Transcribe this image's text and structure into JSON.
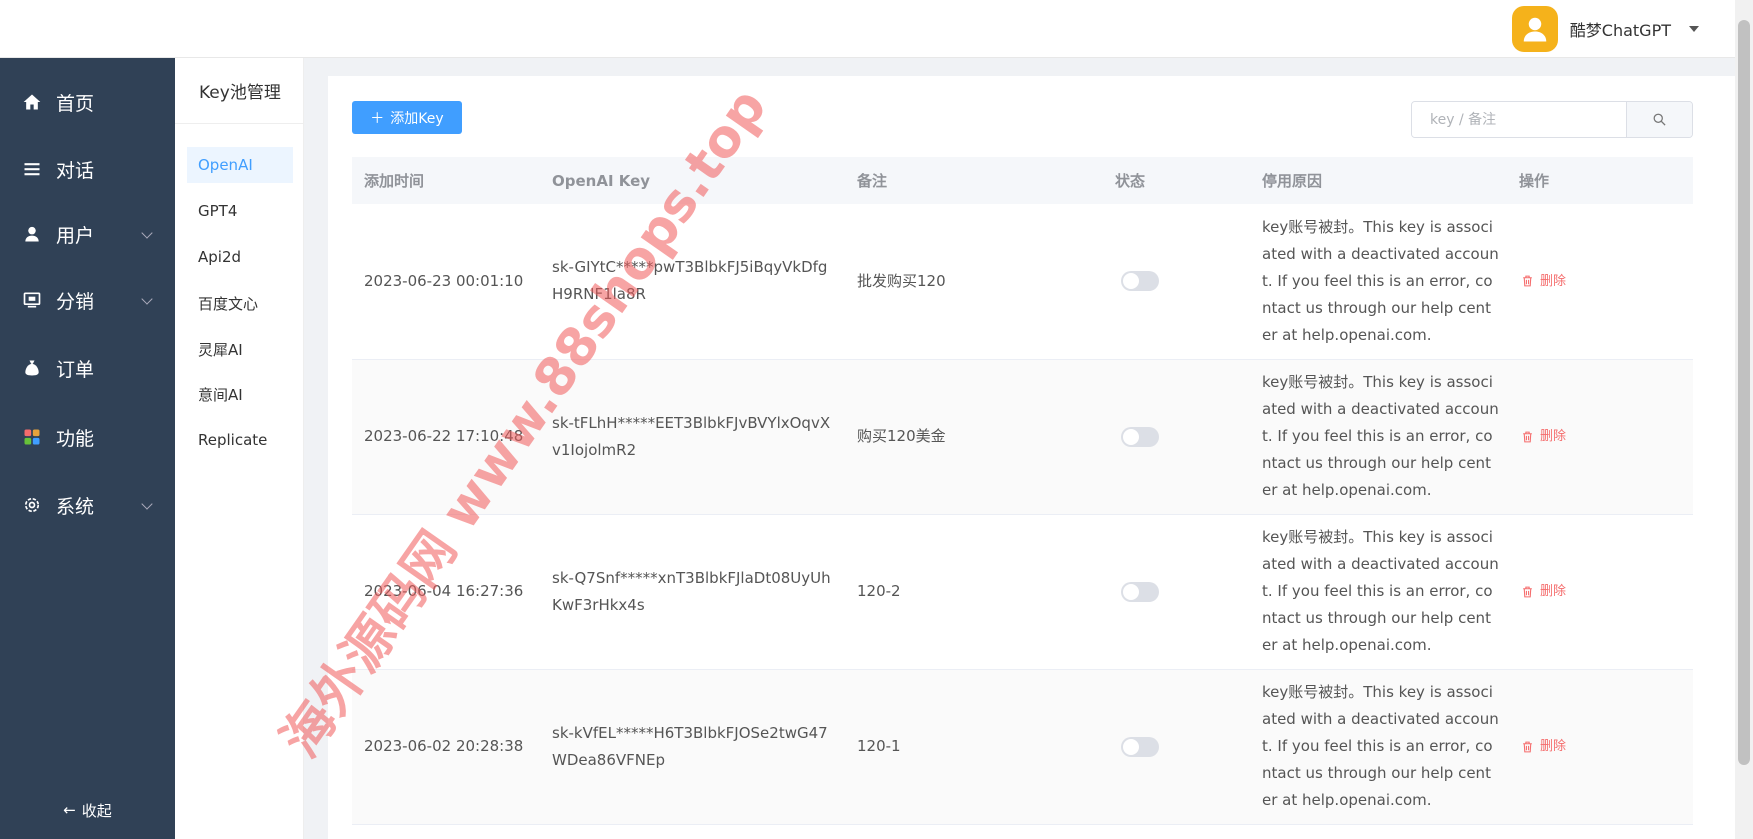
{
  "header": {
    "user_name": "酷梦ChatGPT"
  },
  "sidebar": {
    "items": [
      {
        "label": "首页",
        "icon": "home-icon",
        "has_submenu": false
      },
      {
        "label": "对话",
        "icon": "list-icon",
        "has_submenu": false
      },
      {
        "label": "用户",
        "icon": "user-icon",
        "has_submenu": true
      },
      {
        "label": "分销",
        "icon": "monitor-icon",
        "has_submenu": true
      },
      {
        "label": "订单",
        "icon": "money-bag-icon",
        "has_submenu": false
      },
      {
        "label": "功能",
        "icon": "grid-icon",
        "has_submenu": false
      },
      {
        "label": "系统",
        "icon": "gear-icon",
        "has_submenu": true
      }
    ],
    "collapse_label": "收起"
  },
  "subsidebar": {
    "title": "Key池管理",
    "items": [
      "OpenAI",
      "GPT4",
      "Api2d",
      "百度文心",
      "灵犀AI",
      "意间AI",
      "Replicate"
    ],
    "active": "OpenAI"
  },
  "toolbar": {
    "add_label": "添加Key",
    "search_placeholder": "key / 备注"
  },
  "table": {
    "columns": [
      "添加时间",
      "OpenAI Key",
      "备注",
      "状态",
      "停用原因",
      "操作"
    ],
    "delete_label": "删除",
    "rows": [
      {
        "time": "2023-06-23 00:01:10",
        "key": "sk-GIYtC*****pwT3BlbkFJ5iBqyVkDfgH9RNF1la8R",
        "note": "批发购买120",
        "enabled": false,
        "reason": "key账号被封。This key is associated with a deactivated account. If you feel this is an error, contact us through our help center at help.openai.com."
      },
      {
        "time": "2023-06-22 17:10:48",
        "key": "sk-tFLhH*****EET3BlbkFJvBVYlxOqvXv1IojolmR2",
        "note": "购买120美金",
        "enabled": false,
        "reason": "key账号被封。This key is associated with a deactivated account. If you feel this is an error, contact us through our help center at help.openai.com."
      },
      {
        "time": "2023-06-04 16:27:36",
        "key": "sk-Q7Snf*****xnT3BlbkFJlaDt08UyUhKwF3rHkx4s",
        "note": "120-2",
        "enabled": false,
        "reason": "key账号被封。This key is associated with a deactivated account. If you feel this is an error, contact us through our help center at help.openai.com."
      },
      {
        "time": "2023-06-02 20:28:38",
        "key": "sk-kVfEL*****H6T3BlbkFJOSe2twG47WDea86VFNEp",
        "note": "120-1",
        "enabled": false,
        "reason": "key账号被封。This key is associated with a deactivated account. If you feel this is an error, contact us through our help center at help.openai.com."
      }
    ]
  },
  "watermark": "海外源码网 www.88shops.top",
  "colors": {
    "sidebar_bg": "#304156",
    "primary": "#409eff",
    "danger": "#f56c6c",
    "avatar": "#f5b21b"
  }
}
